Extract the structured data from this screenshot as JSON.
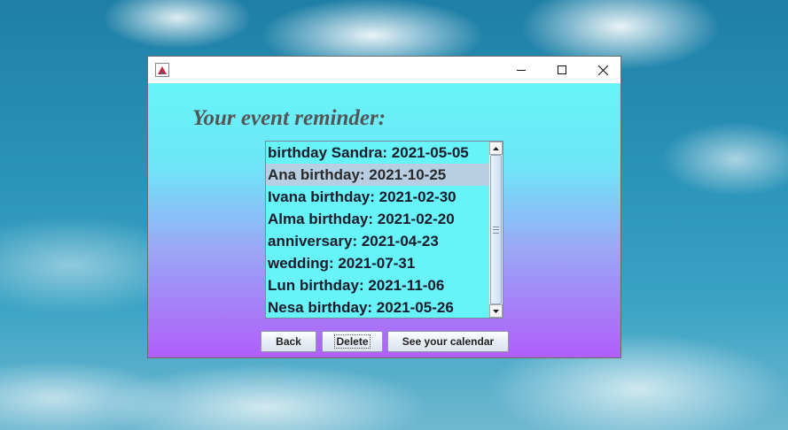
{
  "window": {
    "heading": "Your event reminder:",
    "controls": {
      "minimize": "minimize-icon",
      "maximize": "maximize-icon",
      "close": "close-icon"
    }
  },
  "events": {
    "items": [
      {
        "label": "birthday Sandra: 2021-05-05",
        "selected": false
      },
      {
        "label": "Ana birthday: 2021-10-25",
        "selected": true
      },
      {
        "label": "Ivana birthday: 2021-02-30",
        "selected": false
      },
      {
        "label": "Alma birthday: 2021-02-20",
        "selected": false
      },
      {
        "label": "anniversary: 2021-04-23",
        "selected": false
      },
      {
        "label": "wedding: 2021-07-31",
        "selected": false
      },
      {
        "label": "Lun birthday: 2021-11-06",
        "selected": false
      },
      {
        "label": "Nesa birthday: 2021-05-26",
        "selected": false
      }
    ]
  },
  "buttons": {
    "back": "Back",
    "delete": "Delete",
    "calendar": "See your calendar"
  },
  "colors": {
    "gradient_top": "#66f4f8",
    "gradient_bottom": "#b05efa",
    "heading": "#555555",
    "selection": "#b8cfe3"
  }
}
